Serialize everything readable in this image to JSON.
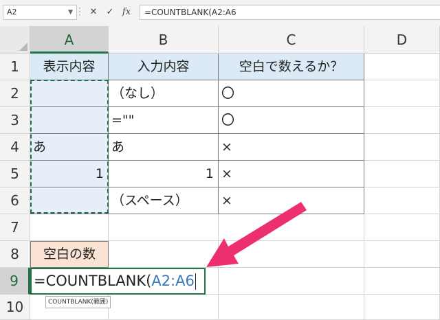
{
  "formula_bar": {
    "name_box": "A2",
    "cancel_icon": "close-icon",
    "enter_icon": "check-icon",
    "function_icon": "fx-icon",
    "cancel_symbol": "✕",
    "enter_symbol": "✓",
    "fx_symbol": "fx",
    "formula_text": "=COUNTBLANK(A2:A6"
  },
  "columns": [
    "A",
    "B",
    "C",
    "D"
  ],
  "rows": [
    "1",
    "2",
    "3",
    "4",
    "5",
    "6",
    "7",
    "8",
    "9",
    "10"
  ],
  "table": {
    "headers": [
      "表示内容",
      "入力内容",
      "空白で数えるか？"
    ],
    "rows": [
      {
        "a": "",
        "b": "（なし）",
        "c": "〇"
      },
      {
        "a": "",
        "b": "=\"\"",
        "c": "〇"
      },
      {
        "a": "あ",
        "b": "あ",
        "c": "×"
      },
      {
        "a": "1",
        "b": "1",
        "c": "×"
      },
      {
        "a": "",
        "b": "（スペース）",
        "c": "×"
      }
    ]
  },
  "label_cell": "空白の数",
  "editing": {
    "prefix": "=COUNTBLANK(",
    "range": "A2:A6"
  },
  "tooltip": "COUNTBLANK(範囲)",
  "colors": {
    "accent_green": "#217346",
    "header_fill": "#dbeaf6",
    "label_fill": "#fbe3d3",
    "arrow": "#ee2f6e",
    "range_ref": "#3c78b5"
  }
}
